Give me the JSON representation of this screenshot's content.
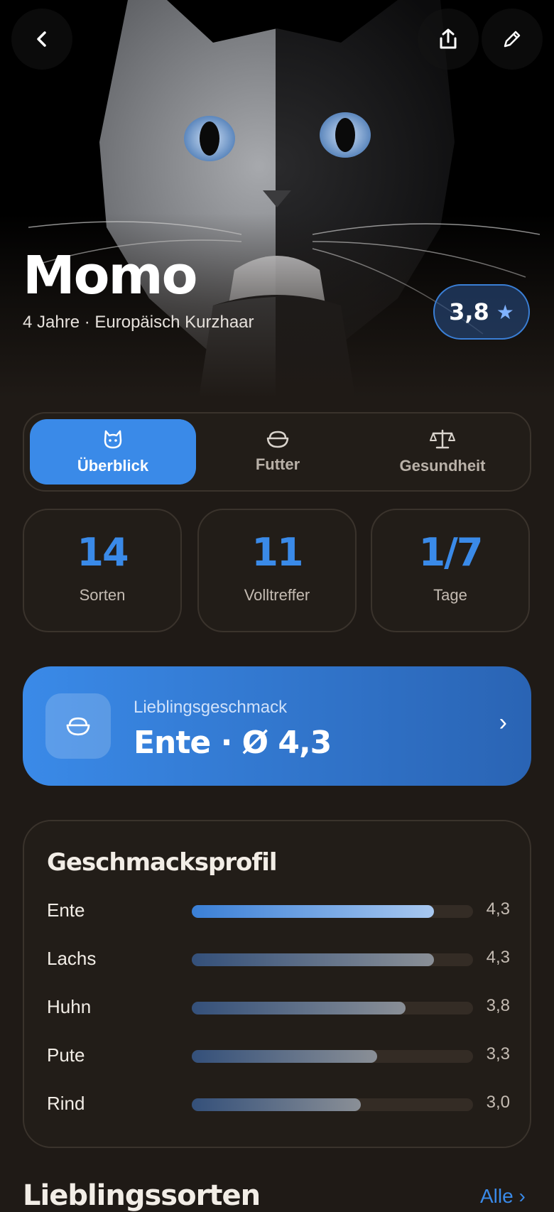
{
  "header": {
    "back_icon": "chevron-left-icon",
    "share_icon": "share-icon",
    "edit_icon": "pencil-icon"
  },
  "pet": {
    "name": "Momo",
    "subtitle": "4 Jahre · Europäisch Kurzhaar",
    "rating": "3,8",
    "rating_icon": "star-icon"
  },
  "tabs": [
    {
      "label": "Überblick",
      "icon": "cat-face-icon",
      "active": true
    },
    {
      "label": "Futter",
      "icon": "bowl-icon",
      "active": false
    },
    {
      "label": "Gesundheit",
      "icon": "scale-icon",
      "active": false
    }
  ],
  "stats": [
    {
      "value": "14",
      "label": "Sorten"
    },
    {
      "value": "11",
      "label": "Volltreffer"
    },
    {
      "value": "1/7",
      "label": "Tage"
    }
  ],
  "favorite": {
    "label": "Lieblingsgeschmack",
    "value": "Ente · Ø 4,3",
    "icon": "bowl-icon"
  },
  "taste_profile": {
    "title": "Geschmacksprofil",
    "max": 5,
    "rows": [
      {
        "name": "Ente",
        "value": "4,3",
        "score": 4.3,
        "highlight": true
      },
      {
        "name": "Lachs",
        "value": "4,3",
        "score": 4.3,
        "highlight": false
      },
      {
        "name": "Huhn",
        "value": "3,8",
        "score": 3.8,
        "highlight": false
      },
      {
        "name": "Pute",
        "value": "3,3",
        "score": 3.3,
        "highlight": false
      },
      {
        "name": "Rind",
        "value": "3,0",
        "score": 3.0,
        "highlight": false
      }
    ]
  },
  "favorites_section": {
    "title": "Lieblingssorten",
    "link": "Alle ›"
  },
  "colors": {
    "accent": "#3a8ae8",
    "background": "#1f1a16",
    "card": "#221d18"
  }
}
